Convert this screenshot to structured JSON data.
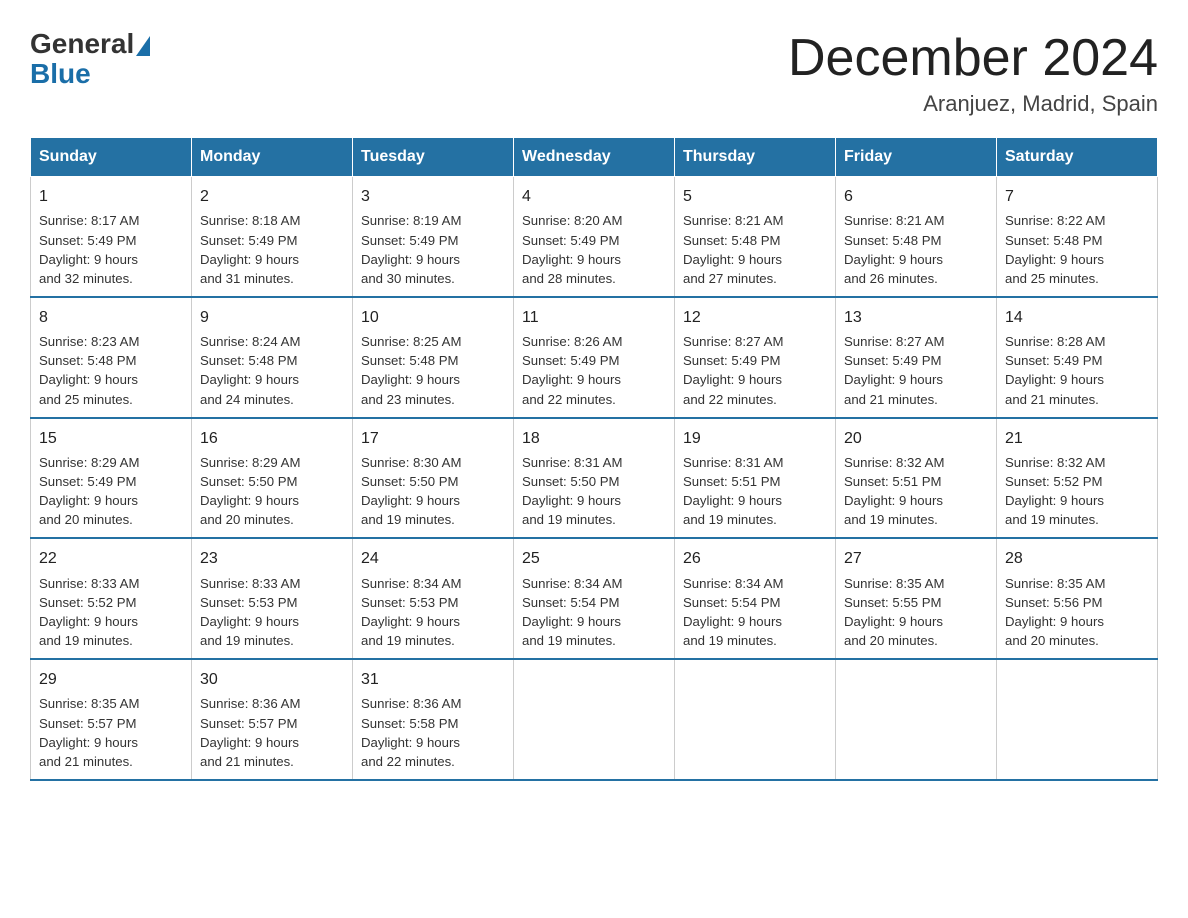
{
  "header": {
    "logo_general": "General",
    "logo_blue": "Blue",
    "month_title": "December 2024",
    "location": "Aranjuez, Madrid, Spain"
  },
  "weekdays": [
    "Sunday",
    "Monday",
    "Tuesday",
    "Wednesday",
    "Thursday",
    "Friday",
    "Saturday"
  ],
  "weeks": [
    [
      {
        "day": "1",
        "sunrise": "8:17 AM",
        "sunset": "5:49 PM",
        "daylight": "9 hours and 32 minutes."
      },
      {
        "day": "2",
        "sunrise": "8:18 AM",
        "sunset": "5:49 PM",
        "daylight": "9 hours and 31 minutes."
      },
      {
        "day": "3",
        "sunrise": "8:19 AM",
        "sunset": "5:49 PM",
        "daylight": "9 hours and 30 minutes."
      },
      {
        "day": "4",
        "sunrise": "8:20 AM",
        "sunset": "5:49 PM",
        "daylight": "9 hours and 28 minutes."
      },
      {
        "day": "5",
        "sunrise": "8:21 AM",
        "sunset": "5:48 PM",
        "daylight": "9 hours and 27 minutes."
      },
      {
        "day": "6",
        "sunrise": "8:21 AM",
        "sunset": "5:48 PM",
        "daylight": "9 hours and 26 minutes."
      },
      {
        "day": "7",
        "sunrise": "8:22 AM",
        "sunset": "5:48 PM",
        "daylight": "9 hours and 25 minutes."
      }
    ],
    [
      {
        "day": "8",
        "sunrise": "8:23 AM",
        "sunset": "5:48 PM",
        "daylight": "9 hours and 25 minutes."
      },
      {
        "day": "9",
        "sunrise": "8:24 AM",
        "sunset": "5:48 PM",
        "daylight": "9 hours and 24 minutes."
      },
      {
        "day": "10",
        "sunrise": "8:25 AM",
        "sunset": "5:48 PM",
        "daylight": "9 hours and 23 minutes."
      },
      {
        "day": "11",
        "sunrise": "8:26 AM",
        "sunset": "5:49 PM",
        "daylight": "9 hours and 22 minutes."
      },
      {
        "day": "12",
        "sunrise": "8:27 AM",
        "sunset": "5:49 PM",
        "daylight": "9 hours and 22 minutes."
      },
      {
        "day": "13",
        "sunrise": "8:27 AM",
        "sunset": "5:49 PM",
        "daylight": "9 hours and 21 minutes."
      },
      {
        "day": "14",
        "sunrise": "8:28 AM",
        "sunset": "5:49 PM",
        "daylight": "9 hours and 21 minutes."
      }
    ],
    [
      {
        "day": "15",
        "sunrise": "8:29 AM",
        "sunset": "5:49 PM",
        "daylight": "9 hours and 20 minutes."
      },
      {
        "day": "16",
        "sunrise": "8:29 AM",
        "sunset": "5:50 PM",
        "daylight": "9 hours and 20 minutes."
      },
      {
        "day": "17",
        "sunrise": "8:30 AM",
        "sunset": "5:50 PM",
        "daylight": "9 hours and 19 minutes."
      },
      {
        "day": "18",
        "sunrise": "8:31 AM",
        "sunset": "5:50 PM",
        "daylight": "9 hours and 19 minutes."
      },
      {
        "day": "19",
        "sunrise": "8:31 AM",
        "sunset": "5:51 PM",
        "daylight": "9 hours and 19 minutes."
      },
      {
        "day": "20",
        "sunrise": "8:32 AM",
        "sunset": "5:51 PM",
        "daylight": "9 hours and 19 minutes."
      },
      {
        "day": "21",
        "sunrise": "8:32 AM",
        "sunset": "5:52 PM",
        "daylight": "9 hours and 19 minutes."
      }
    ],
    [
      {
        "day": "22",
        "sunrise": "8:33 AM",
        "sunset": "5:52 PM",
        "daylight": "9 hours and 19 minutes."
      },
      {
        "day": "23",
        "sunrise": "8:33 AM",
        "sunset": "5:53 PM",
        "daylight": "9 hours and 19 minutes."
      },
      {
        "day": "24",
        "sunrise": "8:34 AM",
        "sunset": "5:53 PM",
        "daylight": "9 hours and 19 minutes."
      },
      {
        "day": "25",
        "sunrise": "8:34 AM",
        "sunset": "5:54 PM",
        "daylight": "9 hours and 19 minutes."
      },
      {
        "day": "26",
        "sunrise": "8:34 AM",
        "sunset": "5:54 PM",
        "daylight": "9 hours and 19 minutes."
      },
      {
        "day": "27",
        "sunrise": "8:35 AM",
        "sunset": "5:55 PM",
        "daylight": "9 hours and 20 minutes."
      },
      {
        "day": "28",
        "sunrise": "8:35 AM",
        "sunset": "5:56 PM",
        "daylight": "9 hours and 20 minutes."
      }
    ],
    [
      {
        "day": "29",
        "sunrise": "8:35 AM",
        "sunset": "5:57 PM",
        "daylight": "9 hours and 21 minutes."
      },
      {
        "day": "30",
        "sunrise": "8:36 AM",
        "sunset": "5:57 PM",
        "daylight": "9 hours and 21 minutes."
      },
      {
        "day": "31",
        "sunrise": "8:36 AM",
        "sunset": "5:58 PM",
        "daylight": "9 hours and 22 minutes."
      },
      null,
      null,
      null,
      null
    ]
  ]
}
